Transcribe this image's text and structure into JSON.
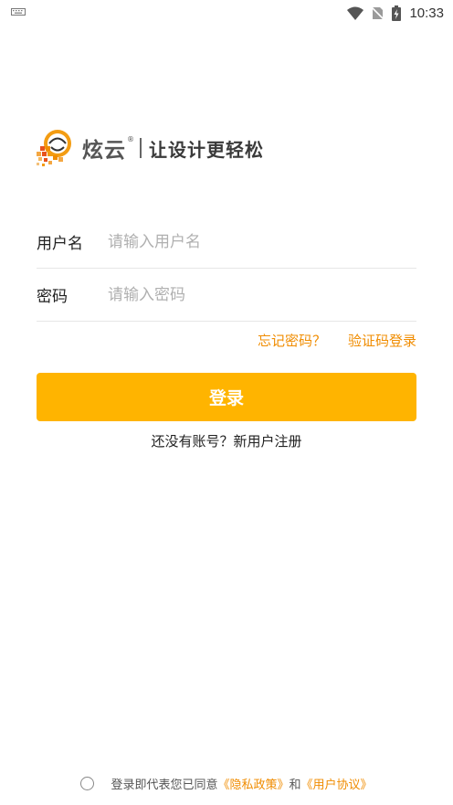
{
  "status_bar": {
    "time": "10:33",
    "icons": [
      "keyboard-icon",
      "wifi-icon",
      "no-sim-icon",
      "battery-charging-icon"
    ]
  },
  "logo": {
    "brand": "炫云",
    "registered": "®",
    "slogan": "让设计更轻松"
  },
  "form": {
    "username": {
      "label": "用户名",
      "placeholder": "请输入用户名",
      "value": ""
    },
    "password": {
      "label": "密码",
      "placeholder": "请输入密码",
      "value": ""
    },
    "forgot_password": "忘记密码？",
    "sms_login": "验证码登录",
    "login_button": "登录",
    "register_prompt": "还没有账号？新用户注册"
  },
  "agreement": {
    "checked": false,
    "prefix": "登录即代表您已同意",
    "privacy_link": "《隐私政策》",
    "and": "和",
    "user_agreement_link": "《用户协议》"
  },
  "colors": {
    "accent": "#ffb400",
    "link": "#f08c00",
    "divider": "#e6e6e6",
    "placeholder": "#b0b0b0"
  }
}
